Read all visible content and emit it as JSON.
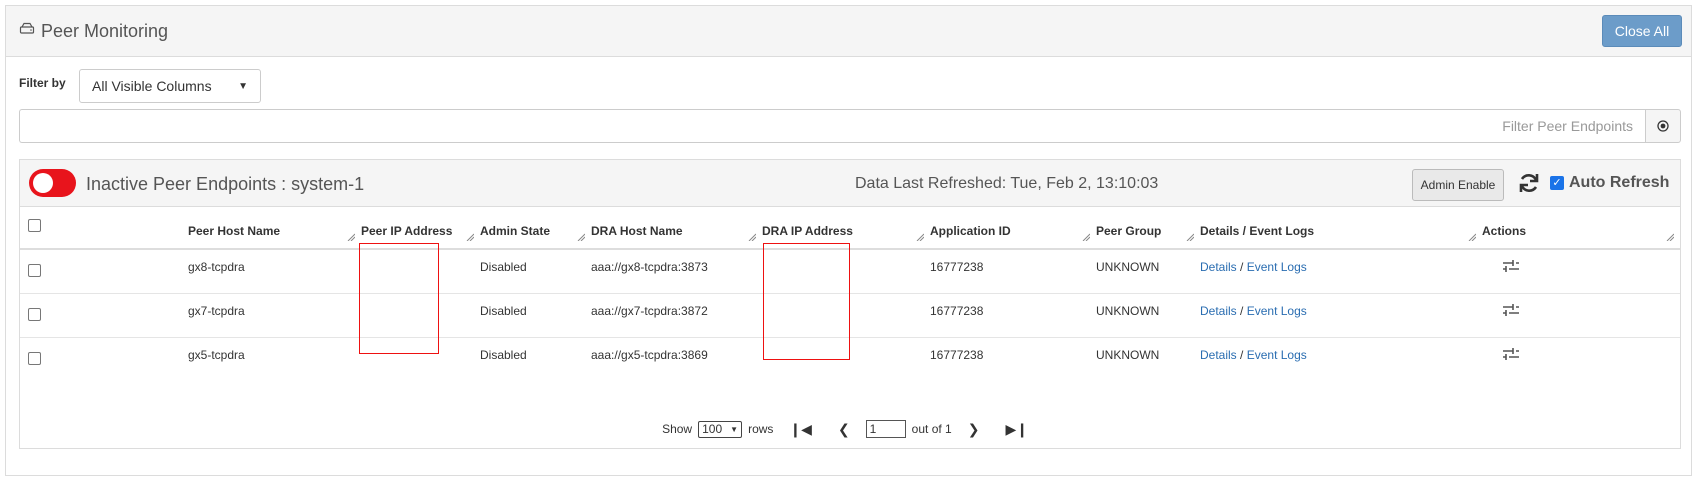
{
  "header": {
    "title": "Peer Monitoring",
    "close_all_label": "Close All"
  },
  "filter": {
    "label": "Filter by",
    "selected": "All Visible Columns",
    "search_placeholder": "Filter Peer Endpoints"
  },
  "subpanel": {
    "title": "Inactive Peer Endpoints : system-1",
    "refreshed": "Data Last Refreshed: Tue, Feb 2, 13:10:03",
    "admin_enable_label": "Admin Enable",
    "auto_refresh_label": "Auto Refresh"
  },
  "table": {
    "columns": [
      "Peer Host Name",
      "Peer IP Address",
      "Admin State",
      "DRA Host Name",
      "DRA IP Address",
      "Application ID",
      "Peer Group",
      "Details / Event Logs",
      "Actions"
    ],
    "rows": [
      {
        "host": "gx8-tcpdra",
        "state": "Disabled",
        "dra_host": "aaa://gx8-tcpdra:3873",
        "app_id": "16777238",
        "group": "UNKNOWN",
        "details": "Details",
        "sep": "/",
        "logs": "Event Logs"
      },
      {
        "host": "gx7-tcpdra",
        "state": "Disabled",
        "dra_host": "aaa://gx7-tcpdra:3872",
        "app_id": "16777238",
        "group": "UNKNOWN",
        "details": "Details",
        "sep": "/",
        "logs": "Event Logs"
      },
      {
        "host": "gx5-tcpdra",
        "state": "Disabled",
        "dra_host": "aaa://gx5-tcpdra:3869",
        "app_id": "16777238",
        "group": "UNKNOWN",
        "details": "Details",
        "sep": "/",
        "logs": "Event Logs"
      }
    ]
  },
  "pager": {
    "show_label": "Show",
    "rows_value": "100",
    "rows_label": "rows",
    "page_value": "1",
    "out_of_label": "out of 1"
  },
  "colors": {
    "accent": "#6c9cc9",
    "toggle_red": "#e8141c",
    "link": "#2a6db1",
    "redaction": "#ee1111"
  }
}
